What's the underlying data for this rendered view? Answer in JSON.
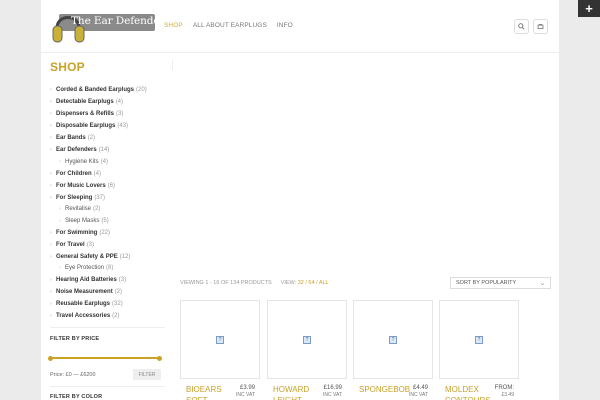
{
  "header": {
    "logo_text": "The Ear Defender",
    "nav": [
      "SHOP",
      "ALL ABOUT EARPLUGS",
      "INFO"
    ],
    "search_icon": "search-icon",
    "cart_icon": "cart-icon"
  },
  "top_right": {
    "plus": "+"
  },
  "sidebar": {
    "title": "SHOP",
    "categories": [
      {
        "label": "Corded & Banded Earplugs",
        "count": "(20)",
        "sub": false
      },
      {
        "label": "Detectable Earplugs",
        "count": "(4)",
        "sub": false
      },
      {
        "label": "Dispensers & Refills",
        "count": "(3)",
        "sub": false
      },
      {
        "label": "Disposable Earplugs",
        "count": "(43)",
        "sub": false
      },
      {
        "label": "Ear Bands",
        "count": "(2)",
        "sub": false
      },
      {
        "label": "Ear Defenders",
        "count": "(14)",
        "sub": false
      },
      {
        "label": "Hygiene Kits",
        "count": "(4)",
        "sub": true
      },
      {
        "label": "For Children",
        "count": "(4)",
        "sub": false
      },
      {
        "label": "For Music Lovers",
        "count": "(6)",
        "sub": false
      },
      {
        "label": "For Sleeping",
        "count": "(37)",
        "sub": false
      },
      {
        "label": "Revitalise",
        "count": "(2)",
        "sub": true
      },
      {
        "label": "Sleep Masks",
        "count": "(5)",
        "sub": true
      },
      {
        "label": "For Swimming",
        "count": "(22)",
        "sub": false
      },
      {
        "label": "For Travel",
        "count": "(3)",
        "sub": false
      },
      {
        "label": "General Safety & PPE",
        "count": "(12)",
        "sub": false
      },
      {
        "label": "Eye Protection",
        "count": "(8)",
        "sub": true
      },
      {
        "label": "Hearing Aid Batteries",
        "count": "(3)",
        "sub": false
      },
      {
        "label": "Noise Measurement",
        "count": "(2)",
        "sub": false
      },
      {
        "label": "Reusable Earplugs",
        "count": "(32)",
        "sub": false
      },
      {
        "label": "Travel Accessories",
        "count": "(2)",
        "sub": false
      }
    ],
    "filter_price": {
      "title": "FILTER BY PRICE",
      "range_text": "Price: £0 — £6200",
      "button": "FILTER"
    },
    "filter_color": {
      "title": "FILTER BY COLOR"
    }
  },
  "toolbar": {
    "viewing": "VIEWING 1 - 16 OF 134 PRODUCTS",
    "view_label": "VIEW:",
    "view_options": "32 / 64 / ALL",
    "sort": "SORT BY POPULARITY"
  },
  "products": [
    {
      "name": "BIOEARS",
      "name2": "SOFT",
      "price": "£3.99",
      "vat": "INC VAT"
    },
    {
      "name": "HOWARD",
      "name2": "LEIGHT",
      "price": "£16.99",
      "vat": "INC VAT"
    },
    {
      "name": "SPONGEBOB",
      "name2": "",
      "price": "£4.49",
      "vat": "INC VAT"
    },
    {
      "name": "MOLDEX",
      "name2": "CONTOURS",
      "price": "FROM:",
      "vat": "£3.49"
    }
  ],
  "colors": {
    "accent": "#c9a227",
    "nav_active": "#c9b037"
  }
}
